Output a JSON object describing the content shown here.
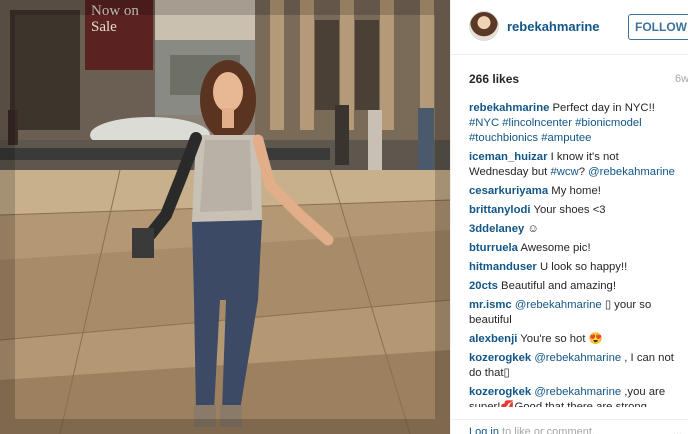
{
  "post": {
    "username": "rebekahmarine",
    "follow_label": "FOLLOW",
    "likes": "266 likes",
    "time_ago": "6w",
    "caption": {
      "user": "rebekahmarine",
      "text": "Perfect day in NYC!!",
      "tags": "#NYC #lincolncenter #bionicmodel #touchbionics #amputee"
    },
    "photo_sign": [
      "Now on",
      "Sale"
    ]
  },
  "comments": [
    {
      "user": "iceman_huizar",
      "text": "I know it's not Wednesday but ",
      "tag": "#wcw",
      "text2": "? ",
      "mention": "@rebekahmarine"
    },
    {
      "user": "cesarkuriyama",
      "text": "My home!"
    },
    {
      "user": "brittanylodi",
      "text": "Your shoes <3"
    },
    {
      "user": "3ddelaney",
      "text": "☺"
    },
    {
      "user": "bturruela",
      "text": "Awesome pic!"
    },
    {
      "user": "hitmanduser",
      "text": "U look so happy!!"
    },
    {
      "user": "20cts",
      "text": "Beautiful and amazing!"
    },
    {
      "user": "mr.ismc",
      "mention": "@rebekahmarine",
      "text2": " ▯ your so beautiful"
    },
    {
      "user": "alexbenji",
      "text": "You're so hot 😍"
    },
    {
      "user": "kozerogkek",
      "mention": "@rebekahmarine",
      "text2": " , I can not do that▯"
    },
    {
      "user": "kozerogkek",
      "mention": "@rebekahmarine",
      "text2": " ,you are super!💋Good that there are strong"
    }
  ],
  "footer": {
    "login_link": "Log in",
    "login_rest": " to like or comment.",
    "more": "..."
  }
}
